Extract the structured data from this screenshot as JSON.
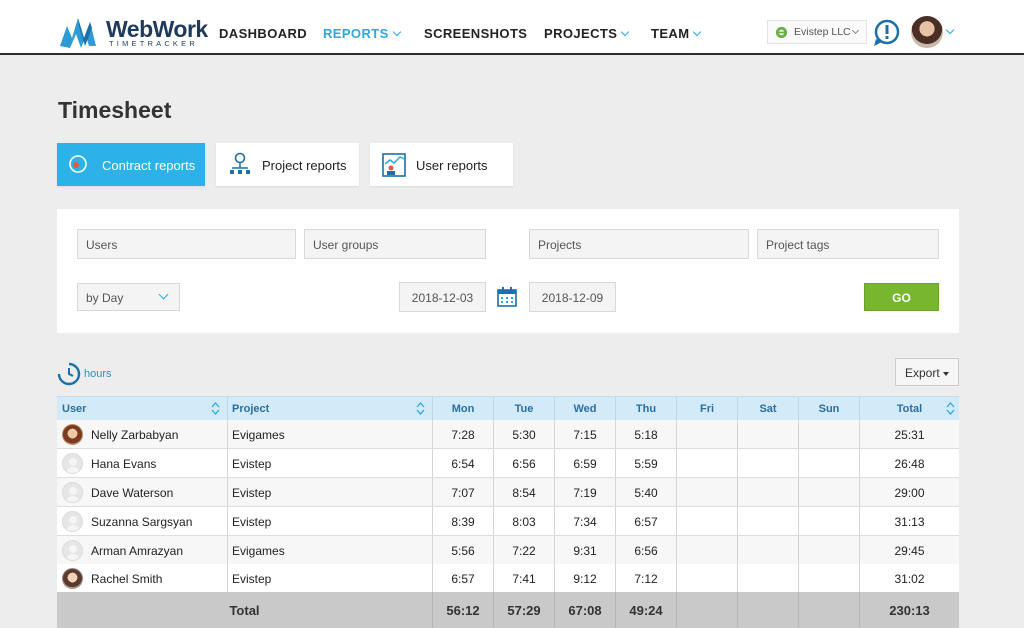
{
  "header": {
    "logo_text": "WebWork",
    "logo_sub": "TIMETRACKER",
    "nav": [
      {
        "label": "DASHBOARD",
        "active": false,
        "has_dropdown": false
      },
      {
        "label": "REPORTS",
        "active": true,
        "has_dropdown": true
      },
      {
        "label": "SCREENSHOTS",
        "active": false,
        "has_dropdown": false
      },
      {
        "label": "PROJECTS",
        "active": false,
        "has_dropdown": true
      },
      {
        "label": "TEAM",
        "active": false,
        "has_dropdown": true
      }
    ],
    "company": "Evistep LLC",
    "icons": {
      "company": "company-icon",
      "alert": "alert-icon",
      "avatar": "user-avatar",
      "chevron": "chevron-down-icon"
    }
  },
  "page": {
    "title": "Timesheet"
  },
  "tabs": [
    {
      "label": "Contract reports",
      "active": true,
      "icon": "contract-icon"
    },
    {
      "label": "Project reports",
      "active": false,
      "icon": "hierarchy-icon"
    },
    {
      "label": "User reports",
      "active": false,
      "icon": "user-report-icon"
    }
  ],
  "filters": {
    "users_placeholder": "Users",
    "user_groups_placeholder": "User groups",
    "projects_placeholder": "Projects",
    "project_tags_placeholder": "Project tags",
    "period": "by Day",
    "date_from": "2018-12-03",
    "date_to": "2018-12-09",
    "go_label": "GO"
  },
  "toolbar": {
    "hours_label": "hours",
    "export_label": "Export"
  },
  "table": {
    "columns": [
      "User",
      "Project",
      "Mon",
      "Tue",
      "Wed",
      "Thu",
      "Fri",
      "Sat",
      "Sun",
      "Total"
    ],
    "rows": [
      {
        "user": "Nelly Zarbabyan",
        "project": "Evigames",
        "mon": "7:28",
        "tue": "5:30",
        "wed": "7:15",
        "thu": "5:18",
        "fri": "",
        "sat": "",
        "sun": "",
        "total": "25:31"
      },
      {
        "user": "Hana Evans",
        "project": "Evistep",
        "mon": "6:54",
        "tue": "6:56",
        "wed": "6:59",
        "thu": "5:59",
        "fri": "",
        "sat": "",
        "sun": "",
        "total": "26:48"
      },
      {
        "user": "Dave Waterson",
        "project": "Evistep",
        "mon": "7:07",
        "tue": "8:54",
        "wed": "7:19",
        "thu": "5:40",
        "fri": "",
        "sat": "",
        "sun": "",
        "total": "29:00"
      },
      {
        "user": "Suzanna Sargsyan",
        "project": "Evistep",
        "mon": "8:39",
        "tue": "8:03",
        "wed": "7:34",
        "thu": "6:57",
        "fri": "",
        "sat": "",
        "sun": "",
        "total": "31:13"
      },
      {
        "user": "Arman Amrazyan",
        "project": "Evigames",
        "mon": "5:56",
        "tue": "7:22",
        "wed": "9:31",
        "thu": "6:56",
        "fri": "",
        "sat": "",
        "sun": "",
        "total": "29:45"
      },
      {
        "user": "Rachel Smith",
        "project": "Evistep",
        "mon": "6:57",
        "tue": "7:41",
        "wed": "9:12",
        "thu": "7:12",
        "fri": "",
        "sat": "",
        "sun": "",
        "total": "31:02"
      }
    ],
    "totals": {
      "label": "Total",
      "mon": "56:12",
      "tue": "57:29",
      "wed": "67:08",
      "thu": "49:24",
      "fri": "",
      "sat": "",
      "sun": "",
      "total": "230:13"
    }
  },
  "colors": {
    "accent": "#2aa9e0",
    "tab_active": "#2cb2e6",
    "go": "#78b630",
    "table_header": "#d3eaf8",
    "total_row": "#c9c9c9"
  }
}
